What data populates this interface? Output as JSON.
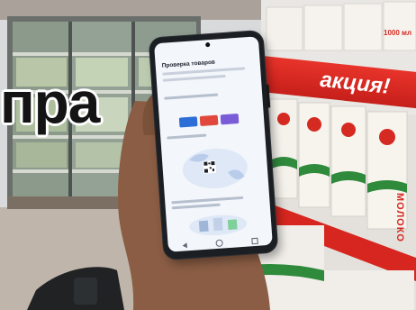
{
  "headline": {
    "text": "пра"
  },
  "promo": {
    "text": "акция!",
    "left_text": "акция"
  },
  "cartons": {
    "top_label": "1000 мл",
    "side_label": "МОЛОКО"
  },
  "phone": {
    "app_title": "Проверка товаров",
    "icons": [
      "camera-icon",
      "back-nav-icon",
      "home-nav-icon",
      "recent-apps-nav-icon"
    ]
  },
  "colors": {
    "promo_red": "#d42a22",
    "screen_bg": "#f3f6fb",
    "phone_body": "#1b1e22",
    "card_blue": "#2d6fd6",
    "card_red": "#e1473c",
    "card_purple": "#7a5bd8"
  }
}
